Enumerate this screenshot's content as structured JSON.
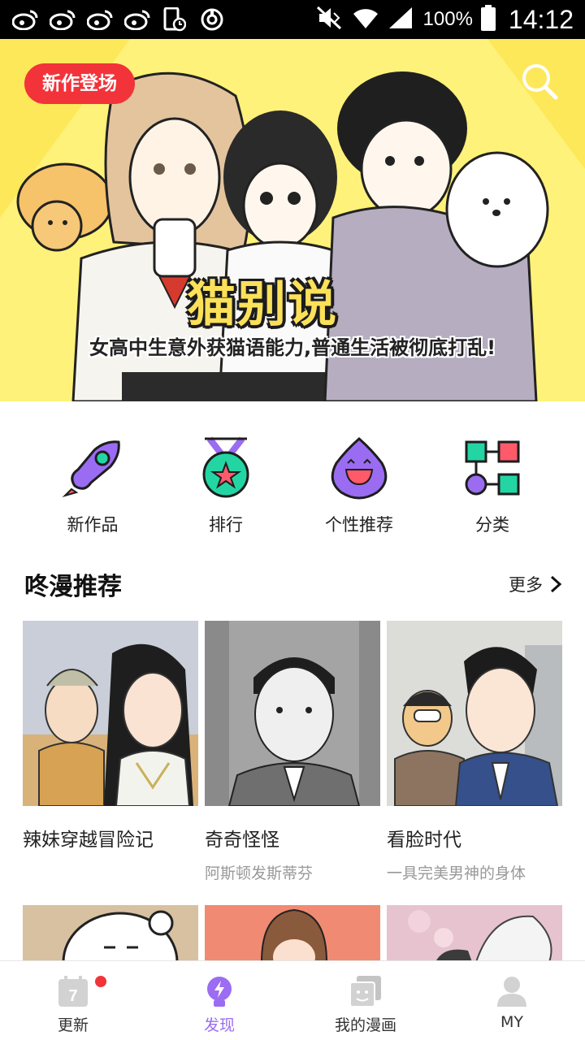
{
  "status_bar": {
    "icons": [
      "weibo-icon",
      "weibo-icon",
      "weibo-icon",
      "weibo-icon",
      "phone-clock-icon",
      "sync-icon",
      "mute-icon",
      "wifi-icon",
      "signal-icon",
      "battery-icon"
    ],
    "battery": "100%",
    "time": "14:12"
  },
  "banner": {
    "tag": "新作登场",
    "title": "猫别说",
    "subtitle": "女高中生意外获猫语能力,普通生活被彻底打乱!",
    "colors": {
      "background": "#fff27a",
      "tag": "#f2333a"
    }
  },
  "quick_nav": [
    {
      "label": "新作品",
      "icon": "rocket-icon"
    },
    {
      "label": "排行",
      "icon": "medal-icon"
    },
    {
      "label": "个性推荐",
      "icon": "drop-face-icon"
    },
    {
      "label": "分类",
      "icon": "category-icon"
    }
  ],
  "section": {
    "title": "咚漫推荐",
    "more": "更多"
  },
  "cards": [
    {
      "title": "辣妹穿越冒险记",
      "subtitle": ""
    },
    {
      "title": "奇奇怪怪",
      "subtitle": "阿斯顿发斯蒂芬"
    },
    {
      "title": "看脸时代",
      "subtitle": "一具完美男神的身体"
    }
  ],
  "bottom_nav": {
    "items": [
      {
        "label": "更新",
        "icon": "calendar-icon",
        "badge": "7"
      },
      {
        "label": "发现",
        "icon": "lightning-bulb-icon"
      },
      {
        "label": "我的漫画",
        "icon": "library-icon"
      },
      {
        "label": "MY",
        "icon": "user-icon"
      }
    ],
    "active_color": "#9c6cf2"
  }
}
